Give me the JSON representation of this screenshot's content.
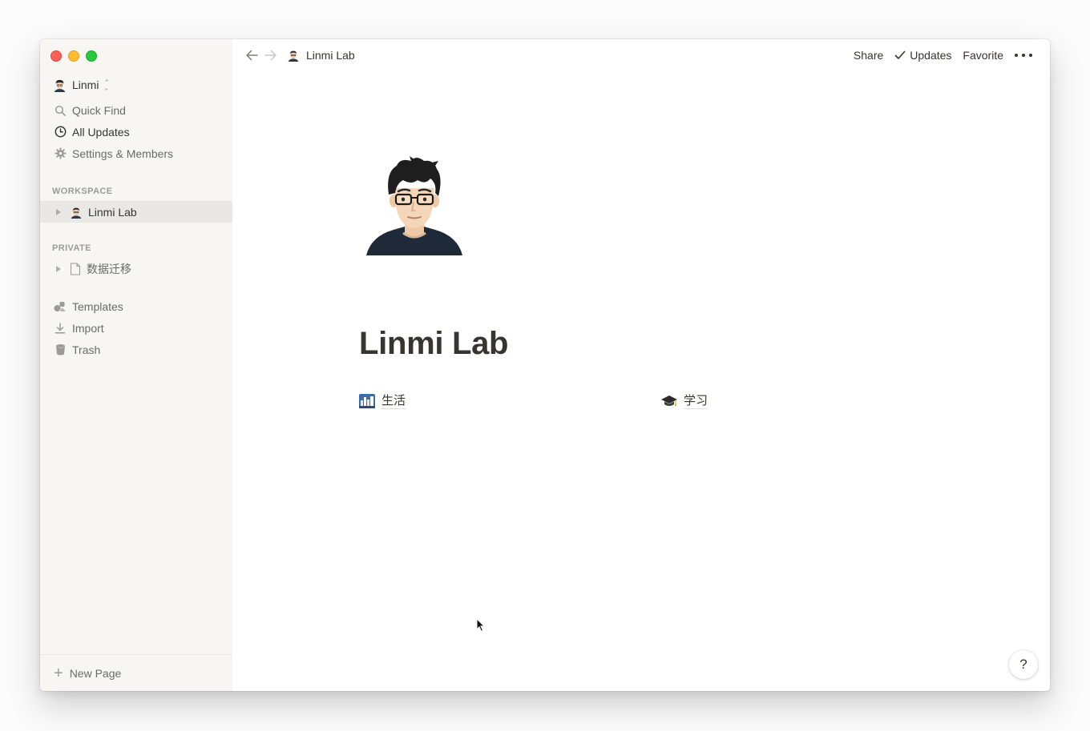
{
  "window": {
    "traffic_lights": [
      "close",
      "minimize",
      "zoom"
    ],
    "colors": {
      "close": "#fe5f57",
      "minimize": "#febc2e",
      "zoom": "#28c840"
    }
  },
  "sidebar": {
    "workspace_name": "Linmi",
    "items": [
      {
        "label": "Quick Find",
        "icon": "search-icon"
      },
      {
        "label": "All Updates",
        "icon": "clock-icon"
      },
      {
        "label": "Settings & Members",
        "icon": "gear-icon"
      }
    ],
    "workspace_section": {
      "heading": "WORKSPACE",
      "pages": [
        {
          "label": "Linmi Lab",
          "icon": "avatar-icon",
          "active": true
        }
      ]
    },
    "private_section": {
      "heading": "PRIVATE",
      "pages": [
        {
          "label": "数据迁移",
          "icon": "page-icon"
        }
      ]
    },
    "tools": [
      {
        "label": "Templates",
        "icon": "templates-icon"
      },
      {
        "label": "Import",
        "icon": "import-icon"
      },
      {
        "label": "Trash",
        "icon": "trash-icon"
      }
    ],
    "new_page_label": "New Page"
  },
  "topbar": {
    "breadcrumb": "Linmi Lab",
    "actions": {
      "share": "Share",
      "updates": "Updates",
      "favorite": "Favorite"
    }
  },
  "page": {
    "title": "Linmi Lab",
    "links": [
      {
        "label": "生活",
        "icon": "cityscape-icon"
      },
      {
        "label": "学习",
        "icon": "graduation-cap-icon"
      }
    ]
  },
  "help_label": "?"
}
